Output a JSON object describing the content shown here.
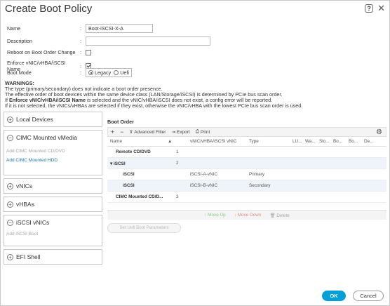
{
  "dialog": {
    "title": "Create Boot Policy",
    "help": "?",
    "close": "✕"
  },
  "form": {
    "name": {
      "label": "Name",
      "value": "Boot-iSCSI-X-A"
    },
    "description": {
      "label": "Description",
      "value": ""
    },
    "reboot": {
      "label": "Reboot on Boot Order Change",
      "checked": false
    },
    "enforce": {
      "label": "Enforce vNIC/vHBA/iSCSI Name",
      "checked": true
    },
    "boot_mode": {
      "label": "Boot Mode",
      "options": [
        "Legacy",
        "Uefi"
      ],
      "selected": "Legacy"
    }
  },
  "warnings": {
    "title": "WARNINGS:",
    "line1": "The type (primary/secondary) does not indicate a boot order presence.",
    "line2": "The effective order of boot devices within the same device class (LAN/Storage/iSCSI) is determined by PCIe bus scan order.",
    "line3_pre": "If ",
    "line3_bold": "Enforce vNIC/vHBA/iSCSI Name",
    "line3_post": " is selected and the vNIC/vHBA/iSCSI does not exist, a config error will be reported.",
    "line4": "If it is not selected, the vNICs/vHBAs are selected if they exist, otherwise the vNIC/vHBA with the lowest PCIe bus scan order is used."
  },
  "left": {
    "local_devices": "Local Devices",
    "cimc_vmedia": "CIMC Mounted vMedia",
    "cimc_cd": "Add CIMC Mounted CD/DVD",
    "cimc_hdd": "Add CIMC Mounted HDD",
    "vnics": "vNICs",
    "vhbas": "vHBAs",
    "iscsi_vnics": "iSCSI vNICs",
    "iscsi_boot": "Add iSCSI Boot",
    "efi_shell": "EFI Shell"
  },
  "boot_order": {
    "title": "Boot Order",
    "toolbar": {
      "add": "+",
      "remove": "−",
      "filter": "Advanced Filter",
      "export": "Export",
      "print": "Print"
    },
    "columns": [
      "Name",
      "▲",
      "vNIC/vHBA/iSCSI vNIC",
      "Type",
      "LU...",
      "Wa...",
      "Slo...",
      "Bo...",
      "Bo...",
      "De..."
    ],
    "rows": [
      {
        "name": "Remote CD/DVD",
        "order": "1",
        "vnic": "",
        "type": ""
      },
      {
        "name": "iSCSI",
        "order": "2",
        "vnic": "",
        "type": ""
      },
      {
        "name": "iSCSI",
        "order": "",
        "vnic": "iSCSI-A-vNIC",
        "type": "Primary"
      },
      {
        "name": "iSCSI",
        "order": "",
        "vnic": "iSCSI-B-vNIC",
        "type": "Secondary"
      },
      {
        "name": "CIMC Mounted CD/D...",
        "order": "3",
        "vnic": "",
        "type": ""
      }
    ],
    "actions": {
      "up": "Move Up",
      "down": "Move Down",
      "delete": "Delete"
    },
    "uefi_btn": "Set Uefi Boot Parameters"
  },
  "footer": {
    "ok": "OK",
    "cancel": "Cancel"
  }
}
